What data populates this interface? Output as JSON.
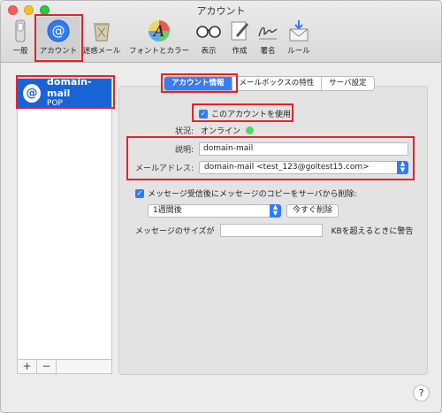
{
  "window": {
    "title": "アカウント"
  },
  "toolbar": {
    "items": [
      {
        "label": "一般",
        "icon": "switch-icon"
      },
      {
        "label": "アカウント",
        "icon": "at-sign-icon"
      },
      {
        "label": "迷惑メール",
        "icon": "trash-junk-icon"
      },
      {
        "label": "フォントとカラー",
        "icon": "font-color-icon"
      },
      {
        "label": "表示",
        "icon": "glasses-icon"
      },
      {
        "label": "作成",
        "icon": "compose-icon"
      },
      {
        "label": "署名",
        "icon": "signature-icon"
      },
      {
        "label": "ルール",
        "icon": "rules-envelope-icon"
      }
    ],
    "selected": "アカウント"
  },
  "accounts": {
    "items": [
      {
        "name": "domain-mail",
        "type": "POP"
      }
    ],
    "add_label": "+",
    "remove_label": "−"
  },
  "tabs": [
    {
      "label": "アカウント情報",
      "active": true
    },
    {
      "label": "メールボックスの特性",
      "active": false
    },
    {
      "label": "サーバ設定",
      "active": false
    }
  ],
  "account_info": {
    "enable_label": "このアカウントを使用",
    "enable_checked": true,
    "status_label": "状況:",
    "status_value": "オンライン",
    "status_color": "#4cd964",
    "description_label": "説明:",
    "description_value": "domain-mail",
    "email_label": "メールアドレス:",
    "email_value": "domain-mail <test_123@goltest15.com>",
    "remove_copy_label": "メッセージ受信後にメッセージのコピーをサーバから削除:",
    "remove_copy_checked": true,
    "remove_after_value": "1週間後",
    "remove_now_label": "今すぐ削除",
    "size_prefix": "メッセージのサイズが",
    "size_value": "",
    "size_suffix": "KBを超えるときに警告"
  },
  "help_label": "?",
  "colors": {
    "accent": "#2f7bf5",
    "selection": "#1a63d6",
    "highlight_box": "#e4232a"
  }
}
